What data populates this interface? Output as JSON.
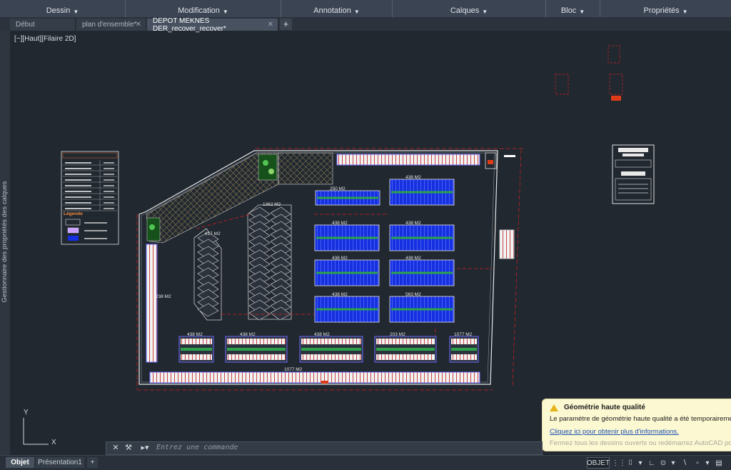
{
  "ribbon": {
    "panels": [
      "Dessin",
      "Modification",
      "Annotation",
      "Calques",
      "Bloc",
      "Propriétés"
    ]
  },
  "tabs": [
    {
      "label": "Début"
    },
    {
      "label": "plan d'ensemble*"
    },
    {
      "label": "DEPOT MEKNES DER_recover_recover*"
    }
  ],
  "side_panel": {
    "label": "Gestionnaire des propriétés des calques"
  },
  "viewport": {
    "label": "[−][Haut][Filaire 2D]"
  },
  "drawing": {
    "areas": [
      "1362 M2",
      "250 M2",
      "438 M2",
      "617 M2",
      "438 M2",
      "438 M2",
      "438 M2",
      "438 M2",
      "438 M2",
      "563 M2",
      "238 M2",
      "438 M2",
      "438 M2",
      "438 M2",
      "203 M2",
      "1077 M2"
    ],
    "legend_heading": "Légende"
  },
  "notification": {
    "title": "Géométrie haute qualité",
    "message": "Le paramètre de géométrie haute qualité a été temporairement d",
    "link": "Cliquez ici pour obtenir plus d'informations.",
    "faded": "Fermez tous les dessins ouverts ou redémarrez AutoCAD pour re"
  },
  "command": {
    "placeholder": "Entrez une commande"
  },
  "status": {
    "layout_tabs": [
      "Objet",
      "Présentation1"
    ],
    "space_button": "OBJET"
  },
  "colors": {
    "canvas": "#212830",
    "blue_block": "#1530e0",
    "red_lines": "#d42020",
    "hatch": "#b8a060"
  }
}
